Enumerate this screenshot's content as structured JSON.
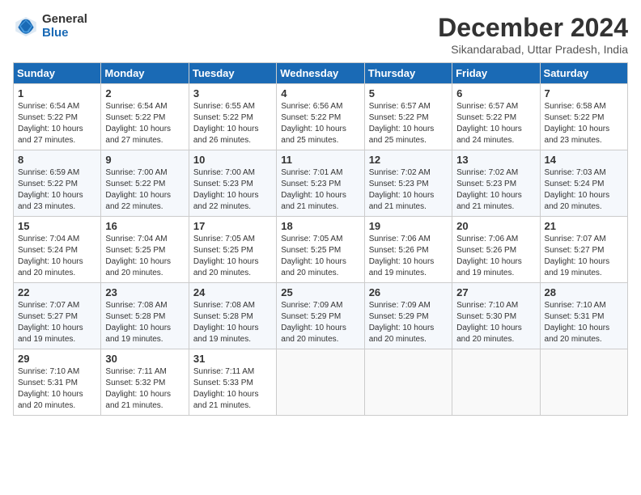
{
  "header": {
    "logo_general": "General",
    "logo_blue": "Blue",
    "month_title": "December 2024",
    "location": "Sikandarabad, Uttar Pradesh, India"
  },
  "days_of_week": [
    "Sunday",
    "Monday",
    "Tuesday",
    "Wednesday",
    "Thursday",
    "Friday",
    "Saturday"
  ],
  "weeks": [
    [
      {
        "day": "1",
        "sunrise": "6:54 AM",
        "sunset": "5:22 PM",
        "daylight": "10 hours and 27 minutes."
      },
      {
        "day": "2",
        "sunrise": "6:54 AM",
        "sunset": "5:22 PM",
        "daylight": "10 hours and 27 minutes."
      },
      {
        "day": "3",
        "sunrise": "6:55 AM",
        "sunset": "5:22 PM",
        "daylight": "10 hours and 26 minutes."
      },
      {
        "day": "4",
        "sunrise": "6:56 AM",
        "sunset": "5:22 PM",
        "daylight": "10 hours and 25 minutes."
      },
      {
        "day": "5",
        "sunrise": "6:57 AM",
        "sunset": "5:22 PM",
        "daylight": "10 hours and 25 minutes."
      },
      {
        "day": "6",
        "sunrise": "6:57 AM",
        "sunset": "5:22 PM",
        "daylight": "10 hours and 24 minutes."
      },
      {
        "day": "7",
        "sunrise": "6:58 AM",
        "sunset": "5:22 PM",
        "daylight": "10 hours and 23 minutes."
      }
    ],
    [
      {
        "day": "8",
        "sunrise": "6:59 AM",
        "sunset": "5:22 PM",
        "daylight": "10 hours and 23 minutes."
      },
      {
        "day": "9",
        "sunrise": "7:00 AM",
        "sunset": "5:22 PM",
        "daylight": "10 hours and 22 minutes."
      },
      {
        "day": "10",
        "sunrise": "7:00 AM",
        "sunset": "5:23 PM",
        "daylight": "10 hours and 22 minutes."
      },
      {
        "day": "11",
        "sunrise": "7:01 AM",
        "sunset": "5:23 PM",
        "daylight": "10 hours and 21 minutes."
      },
      {
        "day": "12",
        "sunrise": "7:02 AM",
        "sunset": "5:23 PM",
        "daylight": "10 hours and 21 minutes."
      },
      {
        "day": "13",
        "sunrise": "7:02 AM",
        "sunset": "5:23 PM",
        "daylight": "10 hours and 21 minutes."
      },
      {
        "day": "14",
        "sunrise": "7:03 AM",
        "sunset": "5:24 PM",
        "daylight": "10 hours and 20 minutes."
      }
    ],
    [
      {
        "day": "15",
        "sunrise": "7:04 AM",
        "sunset": "5:24 PM",
        "daylight": "10 hours and 20 minutes."
      },
      {
        "day": "16",
        "sunrise": "7:04 AM",
        "sunset": "5:25 PM",
        "daylight": "10 hours and 20 minutes."
      },
      {
        "day": "17",
        "sunrise": "7:05 AM",
        "sunset": "5:25 PM",
        "daylight": "10 hours and 20 minutes."
      },
      {
        "day": "18",
        "sunrise": "7:05 AM",
        "sunset": "5:25 PM",
        "daylight": "10 hours and 20 minutes."
      },
      {
        "day": "19",
        "sunrise": "7:06 AM",
        "sunset": "5:26 PM",
        "daylight": "10 hours and 19 minutes."
      },
      {
        "day": "20",
        "sunrise": "7:06 AM",
        "sunset": "5:26 PM",
        "daylight": "10 hours and 19 minutes."
      },
      {
        "day": "21",
        "sunrise": "7:07 AM",
        "sunset": "5:27 PM",
        "daylight": "10 hours and 19 minutes."
      }
    ],
    [
      {
        "day": "22",
        "sunrise": "7:07 AM",
        "sunset": "5:27 PM",
        "daylight": "10 hours and 19 minutes."
      },
      {
        "day": "23",
        "sunrise": "7:08 AM",
        "sunset": "5:28 PM",
        "daylight": "10 hours and 19 minutes."
      },
      {
        "day": "24",
        "sunrise": "7:08 AM",
        "sunset": "5:28 PM",
        "daylight": "10 hours and 19 minutes."
      },
      {
        "day": "25",
        "sunrise": "7:09 AM",
        "sunset": "5:29 PM",
        "daylight": "10 hours and 20 minutes."
      },
      {
        "day": "26",
        "sunrise": "7:09 AM",
        "sunset": "5:29 PM",
        "daylight": "10 hours and 20 minutes."
      },
      {
        "day": "27",
        "sunrise": "7:10 AM",
        "sunset": "5:30 PM",
        "daylight": "10 hours and 20 minutes."
      },
      {
        "day": "28",
        "sunrise": "7:10 AM",
        "sunset": "5:31 PM",
        "daylight": "10 hours and 20 minutes."
      }
    ],
    [
      {
        "day": "29",
        "sunrise": "7:10 AM",
        "sunset": "5:31 PM",
        "daylight": "10 hours and 20 minutes."
      },
      {
        "day": "30",
        "sunrise": "7:11 AM",
        "sunset": "5:32 PM",
        "daylight": "10 hours and 21 minutes."
      },
      {
        "day": "31",
        "sunrise": "7:11 AM",
        "sunset": "5:33 PM",
        "daylight": "10 hours and 21 minutes."
      },
      null,
      null,
      null,
      null
    ]
  ]
}
